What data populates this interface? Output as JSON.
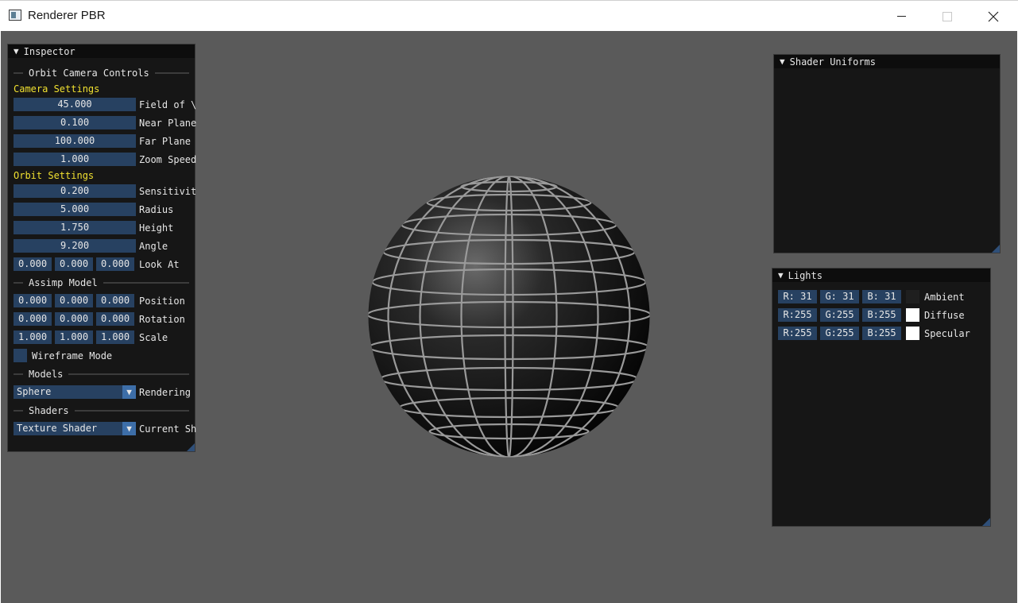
{
  "window": {
    "title": "Renderer PBR"
  },
  "inspector": {
    "title": "Inspector",
    "orbit_header": "Orbit Camera Controls",
    "camera_settings": "Camera Settings",
    "fov": {
      "value": "45.000",
      "label": "Field of \\"
    },
    "near": {
      "value": "0.100",
      "label": "Near Plane"
    },
    "far": {
      "value": "100.000",
      "label": "Far Plane"
    },
    "zoom": {
      "value": "1.000",
      "label": "Zoom Speed"
    },
    "orbit_settings": "Orbit Settings",
    "sensitivity": {
      "value": "0.200",
      "label": "Sensitivit"
    },
    "radius": {
      "value": "5.000",
      "label": "Radius"
    },
    "height": {
      "value": "1.750",
      "label": "Height"
    },
    "angle": {
      "value": "9.200",
      "label": "Angle"
    },
    "look_at": {
      "values": [
        "0.000",
        "0.000",
        "0.000"
      ],
      "label": "Look At"
    },
    "assimp_header": "Assimp Model",
    "position": {
      "values": [
        "0.000",
        "0.000",
        "0.000"
      ],
      "label": "Position"
    },
    "rotation": {
      "values": [
        "0.000",
        "0.000",
        "0.000"
      ],
      "label": "Rotation"
    },
    "scale": {
      "values": [
        "1.000",
        "1.000",
        "1.000"
      ],
      "label": "Scale"
    },
    "wireframe": {
      "label": "Wireframe Mode",
      "checked": false
    },
    "models_header": "Models",
    "model_select": {
      "value": "Sphere",
      "label": "Rendering"
    },
    "shaders_header": "Shaders",
    "shader_select": {
      "value": "Texture Shader",
      "label": "Current Sh"
    }
  },
  "shader_uniforms": {
    "title": "Shader Uniforms"
  },
  "lights": {
    "title": "Lights",
    "rows": [
      {
        "r": "R: 31",
        "g": "G: 31",
        "b": "B: 31",
        "label": "Ambient",
        "color": "#1f1f1f"
      },
      {
        "r": "R:255",
        "g": "G:255",
        "b": "B:255",
        "label": "Diffuse",
        "color": "#ffffff"
      },
      {
        "r": "R:255",
        "g": "G:255",
        "b": "B:255",
        "label": "Specular",
        "color": "#ffffff"
      }
    ]
  },
  "colors": {
    "viewport_bg": "#5a5a5a",
    "field_bg": "#274161",
    "section_text": "#f0e030",
    "panel_bg": "#161616"
  },
  "icons": {
    "collapse": "triangle-down-icon",
    "combo": "chevron-down-icon"
  }
}
